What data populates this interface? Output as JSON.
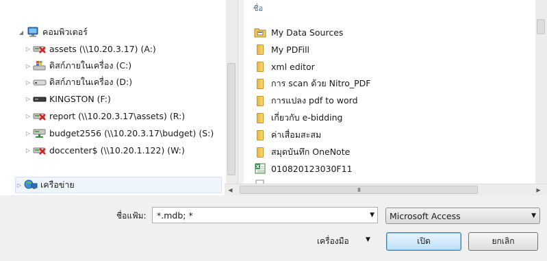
{
  "tree": {
    "items": [
      {
        "label": "คอมพิวเตอร์",
        "expander": "◢",
        "icon": "computer-icon",
        "level": 0
      },
      {
        "label": "assets (\\\\10.20.3.17) (A:)",
        "expander": "▷",
        "icon": "disconnected-network-drive-icon",
        "level": 1
      },
      {
        "label": "ดิสก์ภายในเครื่อง (C:)",
        "expander": "▷",
        "icon": "windows-drive-icon",
        "level": 1
      },
      {
        "label": "ดิสก์ภายในเครื่อง (D:)",
        "expander": "▷",
        "icon": "hard-drive-icon",
        "level": 1
      },
      {
        "label": "KINGSTON (F:)",
        "expander": "▷",
        "icon": "removable-drive-icon",
        "level": 1
      },
      {
        "label": "report (\\\\10.20.3.17\\assets) (R:)",
        "expander": "▷",
        "icon": "disconnected-network-drive-icon",
        "level": 1
      },
      {
        "label": "budget2556 (\\\\10.20.3.17\\budget) (S:)",
        "expander": "▷",
        "icon": "network-drive-icon",
        "level": 1
      },
      {
        "label": "doccenter$ (\\\\10.20.1.122) (W:)",
        "expander": "▷",
        "icon": "disconnected-network-drive-icon",
        "level": 1
      }
    ],
    "network": {
      "label": "เครือข่าย",
      "expander": "▷",
      "icon": "network-icon"
    }
  },
  "files": {
    "column_header": "ชื่อ",
    "items": [
      {
        "label": "My Data Sources",
        "icon": "data-sources-folder-icon"
      },
      {
        "label": "My PDFill",
        "icon": "folder-icon"
      },
      {
        "label": "xml editor",
        "icon": "folder-icon"
      },
      {
        "label": "การ scan ด้วย Nitro_PDF",
        "icon": "folder-icon"
      },
      {
        "label": "การแปลง pdf to word",
        "icon": "folder-icon"
      },
      {
        "label": "เกี่ยวกับ e-bidding",
        "icon": "folder-icon"
      },
      {
        "label": "ค่าเสื่อมสะสม",
        "icon": "folder-icon"
      },
      {
        "label": "สมุดบันทึก OneNote",
        "icon": "folder-icon"
      },
      {
        "label": "010820123030F11",
        "icon": "excel-file-icon"
      }
    ]
  },
  "bottom": {
    "filename_label": "ชื่อแฟ้ม:",
    "filename_value": "*.mdb; *",
    "filter_value": "Microsoft Access",
    "tools_label": "เครื่องมือ",
    "open_label": "เปิด",
    "cancel_label": "ยกเลิก",
    "scroll_grip": "III"
  },
  "colors": {
    "window_bg": "#f0f0f0",
    "pane_bg": "#ffffff",
    "primary_button_border": "#3c7fb1"
  }
}
